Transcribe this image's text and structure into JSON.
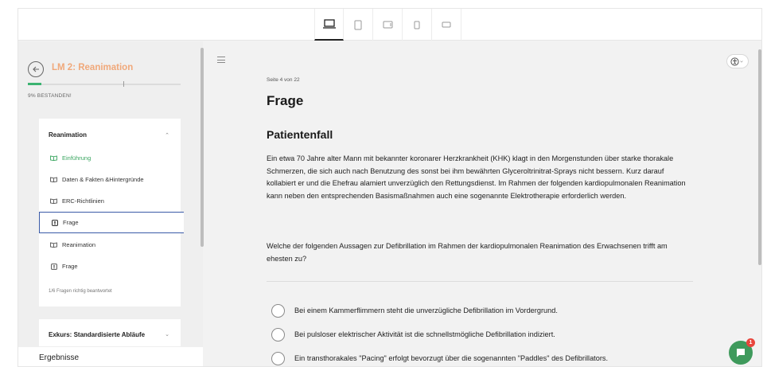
{
  "topbar": {
    "devices": [
      {
        "icon": "laptop-icon",
        "active": true
      },
      {
        "icon": "tablet-portrait-icon",
        "active": false
      },
      {
        "icon": "tablet-landscape-icon",
        "active": false
      },
      {
        "icon": "phone-portrait-icon",
        "active": false
      },
      {
        "icon": "phone-landscape-icon",
        "active": false
      }
    ]
  },
  "sidebar": {
    "module_title": "LM 2: Reanimation",
    "progress_percent": 9,
    "passed_label": "9% BESTANDEN!",
    "section1": {
      "title": "Reanimation",
      "items": [
        {
          "label": "Einführung",
          "icon": "book-icon"
        },
        {
          "label": "Daten & Fakten &Hintergründe",
          "icon": "book-icon"
        },
        {
          "label": "ERC-Richtlinien",
          "icon": "book-icon"
        },
        {
          "label": "Frage",
          "icon": "question-icon"
        },
        {
          "label": "Reanimation",
          "icon": "book-icon"
        },
        {
          "label": "Frage",
          "icon": "question-icon"
        }
      ],
      "footer": "1/6 Fragen richtig beantwortet"
    },
    "section2": {
      "title": "Exkurs: Standardisierte Abläufe"
    },
    "results_label": "Ergebnisse"
  },
  "main": {
    "page_indicator": "Seite 4 von 22",
    "heading": "Frage",
    "case_heading": "Patientenfall",
    "case_text": "Ein etwa 70 Jahre alter Mann mit bekannter koronarer Herzkrankheit (KHK) klagt in den Morgenstunden über starke thorakale Schmerzen, die sich auch nach Benutzung des sonst bei ihm bewährten Glyceroltrinitrat-Sprays nicht bessern. Kurz darauf kollabiert er und die Ehefrau alamiert unverzüglich den Rettungsdienst. Im Rahmen der folgenden kardiopulmonalen Reanimation kann neben den entsprechenden Basismaßnahmen auch eine sogenannte Elektrotherapie erforderlich werden.",
    "question_text": "Welche der folgenden Aussagen zur Defibrillation im Rahmen der kardiopulmonalen Reanimation des Erwachsenen trifft am ehesten zu?",
    "options": [
      "Bei einem Kammerflimmern steht die unverzügliche Defibrillation im Vordergrund.",
      "Bei pulsloser elektrischer Aktivität ist die schnellstmögliche Defibrillation indiziert.",
      "Ein transthorakales \"Pacing\" erfolgt bevorzugt über die sogenannten \"Paddles\" des Defibrillators."
    ]
  },
  "chat": {
    "badge_count": "1"
  },
  "colors": {
    "accent_orange": "#f0a87a",
    "progress_green": "#3cb371",
    "active_border": "#3a5aa8",
    "chat_green": "#3f9a5c",
    "badge_red": "#e8453c"
  }
}
